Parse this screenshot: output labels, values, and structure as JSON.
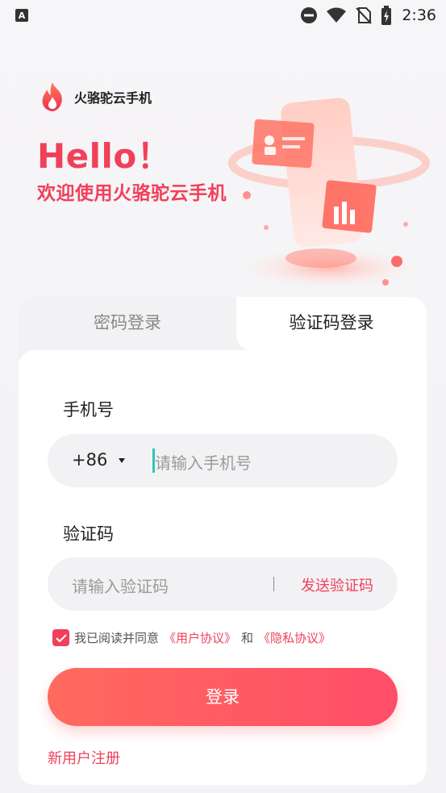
{
  "status_bar": {
    "time": "2:36",
    "icons": [
      "keyboard-a-icon",
      "do-not-disturb-icon",
      "wifi-icon",
      "no-sim-icon",
      "battery-charging-icon"
    ]
  },
  "header": {
    "app_name": "火骆驼云手机",
    "hello": "Hello！",
    "welcome": "欢迎使用火骆驼云手机",
    "logo_icon": "flame-logo-icon",
    "hero_image": "phone-illustration"
  },
  "tabs": [
    {
      "label": "密码登录",
      "active": false
    },
    {
      "label": "验证码登录",
      "active": true
    }
  ],
  "form": {
    "phone_label": "手机号",
    "country_code": "+86",
    "phone_placeholder": "请输入手机号",
    "code_label": "验证码",
    "code_placeholder": "请输入验证码",
    "send_code": "发送验证码",
    "divider": "|"
  },
  "agreement": {
    "checked": true,
    "text_prefix": "我已阅读并同意",
    "user_agreement": "《用户协议》",
    "and": "和",
    "privacy_policy": "《隐私协议》"
  },
  "login_button": "登录",
  "register_link": "新用户注册",
  "colors": {
    "accent": "#f0405a",
    "button_start": "#ff6a5e",
    "button_end": "#ff4d68",
    "cursor": "#2bc7b9"
  }
}
